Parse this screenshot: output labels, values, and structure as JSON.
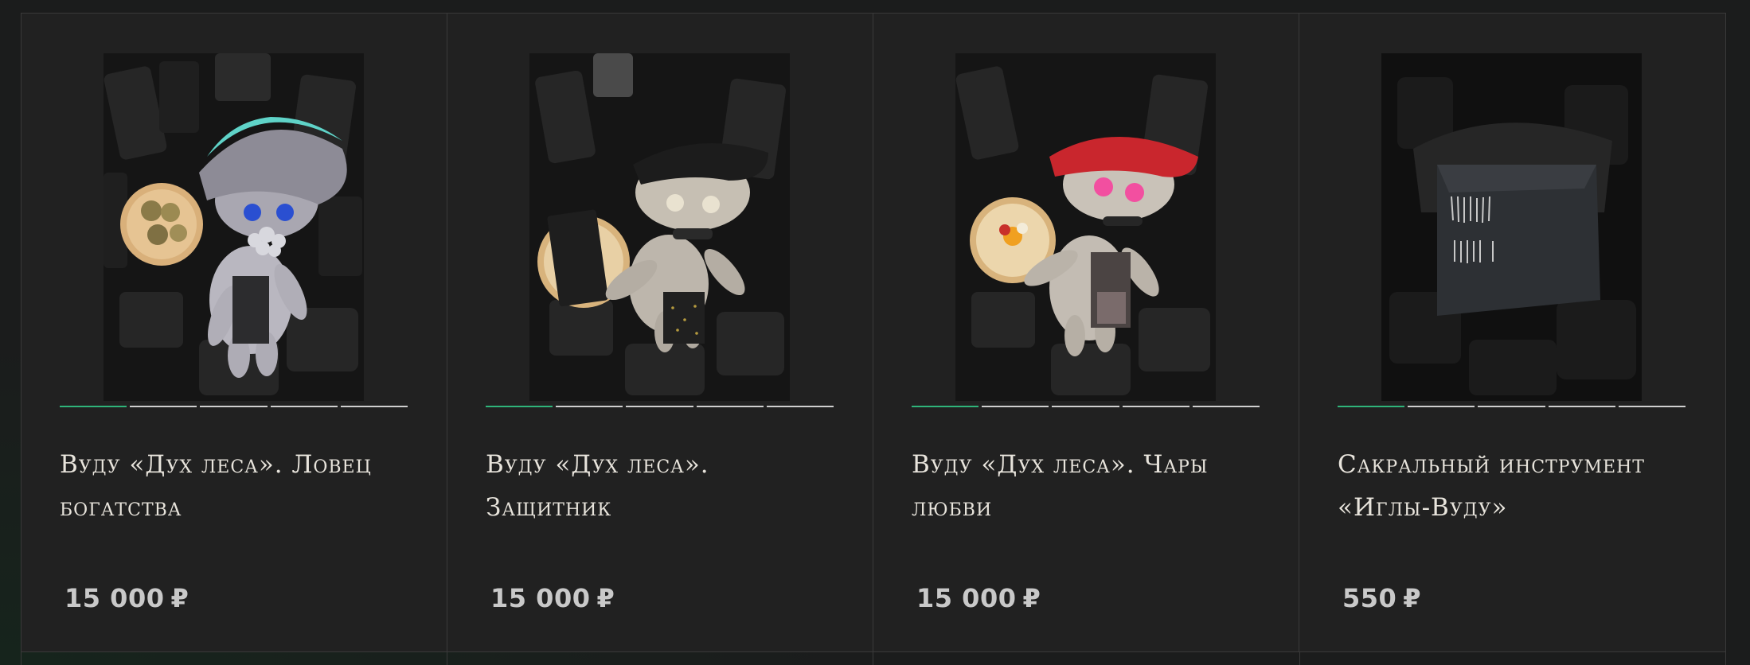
{
  "products": [
    {
      "title": "Вуду «Дух леса». Ловец богатства",
      "price": "15 000",
      "currency": "₽",
      "image": "voodoo-doll-teal-hat-coins",
      "hat_color": "#5fd3c8",
      "eye_color": "#2a4fd1",
      "slides": 5,
      "active_slide": 1
    },
    {
      "title": "Вуду «Дух леса». Защитник",
      "price": "15 000",
      "currency": "₽",
      "image": "voodoo-doll-black-hat",
      "hat_color": "#1c1c1c",
      "eye_color": "#e9e2d0",
      "slides": 5,
      "active_slide": 1
    },
    {
      "title": "Вуду «Дух леса». Чары любви",
      "price": "15 000",
      "currency": "₽",
      "image": "voodoo-doll-red-hat",
      "hat_color": "#c9262d",
      "eye_color": "#f24fa0",
      "slides": 5,
      "active_slide": 1
    },
    {
      "title": "Сакральный инструмент «Иглы-Вуду»",
      "price": "550",
      "currency": "₽",
      "image": "voodoo-needles-pouch",
      "hat_color": "#2d3034",
      "eye_color": "#c8c8c8",
      "slides": 5,
      "active_slide": 1
    }
  ],
  "colors": {
    "background": "#1b1c1c",
    "card": "#212121",
    "border": "#3a3a3a",
    "accent": "#2fb47a",
    "title": "#e8e4dc",
    "price": "#c9c9c9"
  }
}
